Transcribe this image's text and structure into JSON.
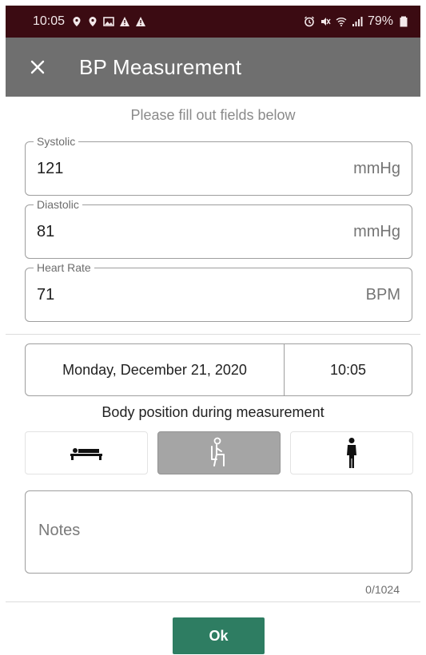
{
  "status_bar": {
    "time": "10:05",
    "battery": "79%",
    "left_icons": [
      "location-pin-icon",
      "location-pin-icon",
      "image-icon",
      "warning-icon",
      "warning-icon"
    ],
    "right_icons": [
      "alarm-icon",
      "mute-icon",
      "wifi-icon",
      "signal-icon",
      "battery-icon"
    ]
  },
  "app_bar": {
    "title": "BP Measurement",
    "close_icon": "close-icon"
  },
  "subtitle": "Please fill out fields below",
  "fields": {
    "systolic": {
      "label": "Systolic",
      "value": "121",
      "unit": "mmHg"
    },
    "diastolic": {
      "label": "Diastolic",
      "value": "81",
      "unit": "mmHg"
    },
    "heart_rate": {
      "label": "Heart Rate",
      "value": "71",
      "unit": "BPM"
    }
  },
  "datetime": {
    "date": "Monday, December 21, 2020",
    "time": "10:05"
  },
  "body_position": {
    "label": "Body position during measurement",
    "options": [
      "lying-icon",
      "sitting-icon",
      "standing-icon"
    ],
    "selected": "sitting"
  },
  "notes": {
    "placeholder": "Notes",
    "counter": "0/1024"
  },
  "ok_button": {
    "label": "Ok"
  },
  "colors": {
    "status_bar": "#3b0b12",
    "app_bar": "#6f6f6f",
    "accent": "#2e7d62",
    "selected_position": "#a5a5a5"
  }
}
